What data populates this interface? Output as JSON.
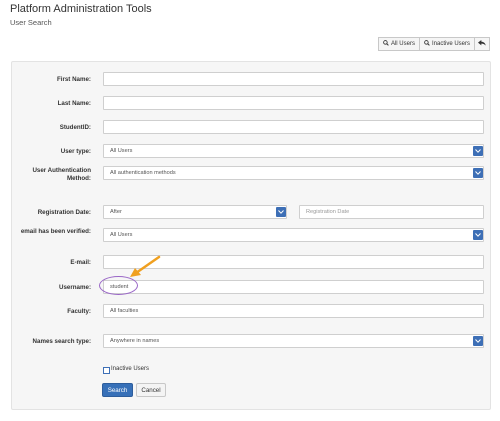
{
  "header": {
    "title": "Platform Administration Tools",
    "subtitle": "User Search"
  },
  "toolbar": {
    "all_users": "All Users",
    "inactive_users": "Inactive Users"
  },
  "form": {
    "first_name_label": "First Name:",
    "last_name_label": "Last Name:",
    "student_id_label": "StudentID:",
    "user_type_label": "User type:",
    "user_type_value": "All Users",
    "auth_method_label": "User Authentication Method:",
    "auth_method_value": "All authentication methods",
    "reg_date_label": "Registration Date:",
    "reg_date_mode": "After",
    "reg_date_placeholder": "Registration Date",
    "email_verified_label": "email has been verified:",
    "email_verified_value": "All Users",
    "email_label": "E-mail:",
    "username_label": "Username:",
    "username_value": "student",
    "faculty_label": "Faculty:",
    "faculty_value": "All faculties",
    "names_search_label": "Names search type:",
    "names_search_value": "Anywhere in names",
    "inactive_checkbox_label": "Inactive Users",
    "search_button": "Search",
    "cancel_button": "Cancel"
  },
  "colors": {
    "accent": "#3770b8",
    "highlight_circle": "#9a67c7",
    "arrow": "#f0a020"
  },
  "icons": [
    "search-icon",
    "back-arrow-icon",
    "chevron-down-icon"
  ]
}
